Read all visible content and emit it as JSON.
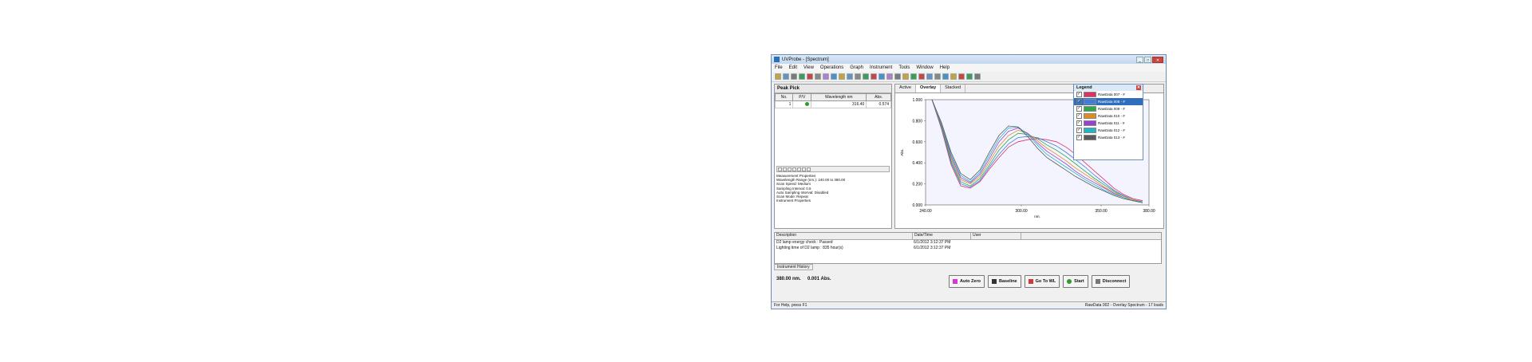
{
  "window": {
    "title": "UVProbe - [Spectrum]"
  },
  "menu": [
    "File",
    "Edit",
    "View",
    "Operations",
    "Graph",
    "Instrument",
    "Tools",
    "Window",
    "Help"
  ],
  "left_panel": {
    "title": "Peak Pick",
    "columns": [
      "No.",
      "P/V",
      "Wavelength nm",
      "Abs."
    ],
    "rows": [
      {
        "no": "1",
        "pv": "",
        "wavelength": "316.40",
        "abs": "0.574"
      }
    ],
    "properties": [
      "Measurement Properties",
      "Wavelength Range (nm.):   240.00 to 380.00",
      "Scan Speed:          Medium",
      "Sampling Interval:   0.5",
      "Auto Sampling Interval:   Disabled",
      "Scan Mode:           Repeat",
      "Instrument Properties"
    ]
  },
  "tabs": [
    "Active",
    "Overlay",
    "Stacked"
  ],
  "active_tab": "Overlay",
  "chart_data": {
    "type": "line",
    "xlabel": "nm.",
    "ylabel": "Abs.",
    "xlim": [
      240,
      380
    ],
    "ylim": [
      0,
      1.0
    ],
    "x_ticks": [
      "240.00",
      "300.00",
      "350.00",
      "380.00"
    ],
    "y_ticks": [
      "1.000",
      "0.800",
      "0.600",
      "0.400",
      "0.200",
      "0.000"
    ],
    "x": [
      244,
      250,
      256,
      262,
      268,
      274,
      280,
      286,
      292,
      298,
      304,
      310,
      316,
      322,
      328,
      334,
      340,
      346,
      352,
      358,
      364,
      370,
      376
    ],
    "series": [
      {
        "name": "RawData 007 - #",
        "color": "#e0306a",
        "values": [
          1.0,
          0.72,
          0.38,
          0.18,
          0.16,
          0.22,
          0.34,
          0.45,
          0.55,
          0.6,
          0.62,
          0.63,
          0.62,
          0.6,
          0.55,
          0.48,
          0.4,
          0.32,
          0.24,
          0.16,
          0.1,
          0.06,
          0.04
        ]
      },
      {
        "name": "RawData 008 - #",
        "color": "#3a7de0",
        "values": [
          1.0,
          0.73,
          0.4,
          0.2,
          0.17,
          0.23,
          0.36,
          0.48,
          0.58,
          0.64,
          0.65,
          0.64,
          0.6,
          0.56,
          0.5,
          0.43,
          0.36,
          0.28,
          0.21,
          0.14,
          0.09,
          0.05,
          0.03
        ]
      },
      {
        "name": "RawData 009 - #",
        "color": "#2aa84a",
        "values": [
          1.0,
          0.74,
          0.42,
          0.22,
          0.18,
          0.25,
          0.38,
          0.52,
          0.62,
          0.68,
          0.67,
          0.63,
          0.57,
          0.52,
          0.46,
          0.39,
          0.32,
          0.25,
          0.19,
          0.13,
          0.08,
          0.05,
          0.03
        ]
      },
      {
        "name": "RawData 010 - #",
        "color": "#e08a20",
        "values": [
          1.0,
          0.75,
          0.44,
          0.24,
          0.2,
          0.27,
          0.41,
          0.56,
          0.66,
          0.71,
          0.68,
          0.61,
          0.54,
          0.48,
          0.42,
          0.35,
          0.29,
          0.23,
          0.17,
          0.12,
          0.08,
          0.05,
          0.03
        ]
      },
      {
        "name": "RawData 011 - #",
        "color": "#9b3fd1",
        "values": [
          1.0,
          0.76,
          0.46,
          0.26,
          0.21,
          0.29,
          0.44,
          0.6,
          0.7,
          0.73,
          0.68,
          0.59,
          0.51,
          0.45,
          0.39,
          0.32,
          0.26,
          0.21,
          0.16,
          0.11,
          0.07,
          0.04,
          0.03
        ]
      },
      {
        "name": "RawData 012 - #",
        "color": "#1fb6c9",
        "values": [
          1.0,
          0.77,
          0.48,
          0.28,
          0.22,
          0.31,
          0.47,
          0.63,
          0.73,
          0.74,
          0.67,
          0.57,
          0.48,
          0.42,
          0.36,
          0.3,
          0.24,
          0.19,
          0.14,
          0.1,
          0.07,
          0.04,
          0.03
        ]
      },
      {
        "name": "RawData 013 - #",
        "color": "#5a5a5a",
        "values": [
          1.0,
          0.78,
          0.5,
          0.3,
          0.24,
          0.33,
          0.5,
          0.66,
          0.75,
          0.74,
          0.65,
          0.54,
          0.45,
          0.39,
          0.33,
          0.27,
          0.22,
          0.17,
          0.13,
          0.09,
          0.06,
          0.04,
          0.02
        ]
      }
    ]
  },
  "legend": {
    "title": "Legend"
  },
  "history": {
    "columns": [
      "Description",
      "Date/Time",
      "User"
    ],
    "rows": [
      {
        "desc": "D2 lamp energy check : Passed",
        "date": "6/1/2012 3:12:37 PM"
      },
      {
        "desc": "Lighting time of D2 lamp : 835 hour(s)",
        "date": "6/1/2012 3:12:37 PM"
      }
    ],
    "tab": "Instrument History"
  },
  "readout": {
    "wavelength": "380.00 nm.",
    "abs": "0.001 Abs."
  },
  "actions": [
    "Auto Zero",
    "Baseline",
    "Go To WL",
    "Start",
    "Disconnect"
  ],
  "status": {
    "left": "For Help, press F1",
    "right": "RawData 002 - Overlay Spectrum - 17 loads"
  }
}
